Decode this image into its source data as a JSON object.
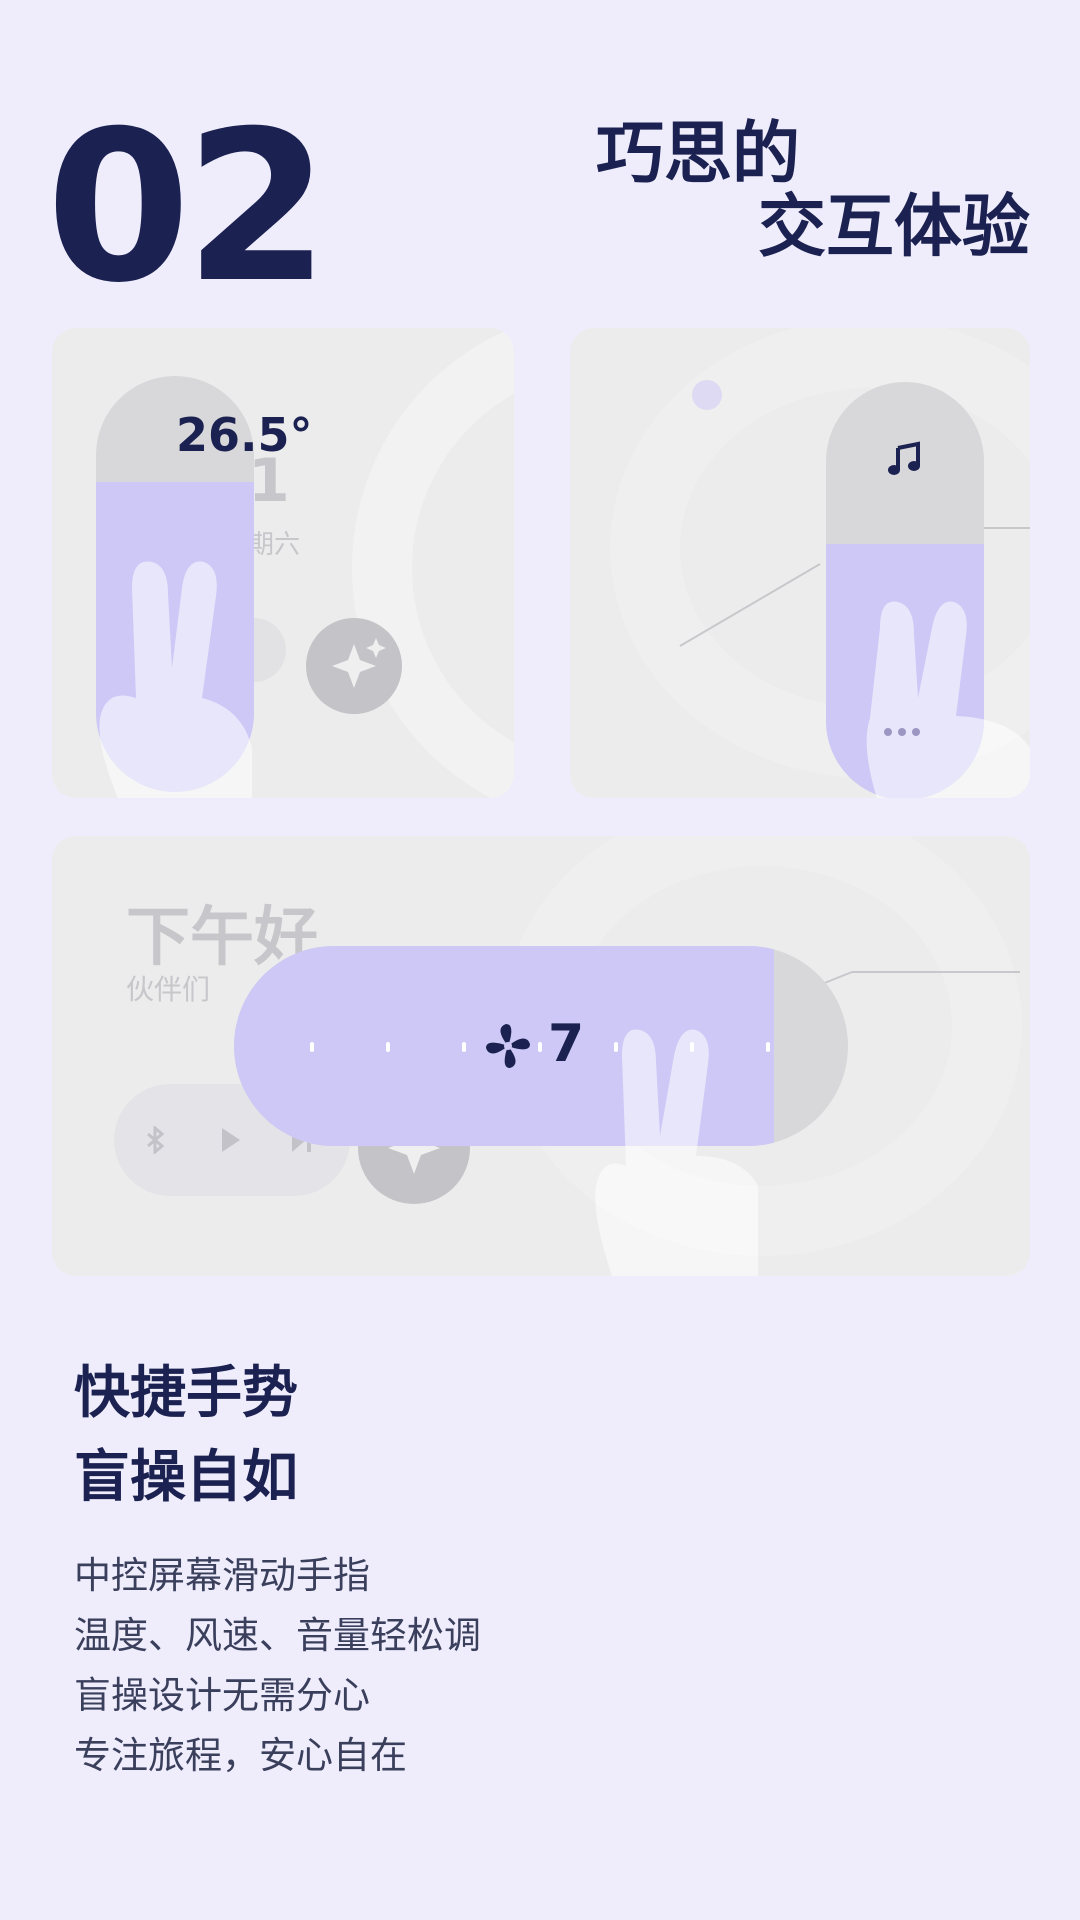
{
  "header": {
    "number": "02",
    "title_line1": "巧思的",
    "title_line2": "交互体验"
  },
  "card_temperature": {
    "temperature": "26.5°",
    "bg_date_partial": "1",
    "bg_weekday_partial": "期六"
  },
  "card_music": {
    "icon": "music-note-icon",
    "more_icon": "more-dots-icon"
  },
  "card_fan": {
    "bg_greeting": "下午好",
    "bg_subgreeting": "伙伴们",
    "fan_speed": "7",
    "fan_icon": "fan-icon",
    "fan_level_fraction": 0.88
  },
  "feature": {
    "title_line1": "快捷手势",
    "title_line2": "盲操自如",
    "desc": [
      "中控屏幕滑动手指",
      "温度、风速、音量轻松调",
      "盲操设计无需分心",
      "专注旅程，安心自在"
    ]
  },
  "colors": {
    "background": "#efedfc",
    "navy": "#1b2150",
    "lavender": "#cdc8f6",
    "card": "#ececec"
  }
}
